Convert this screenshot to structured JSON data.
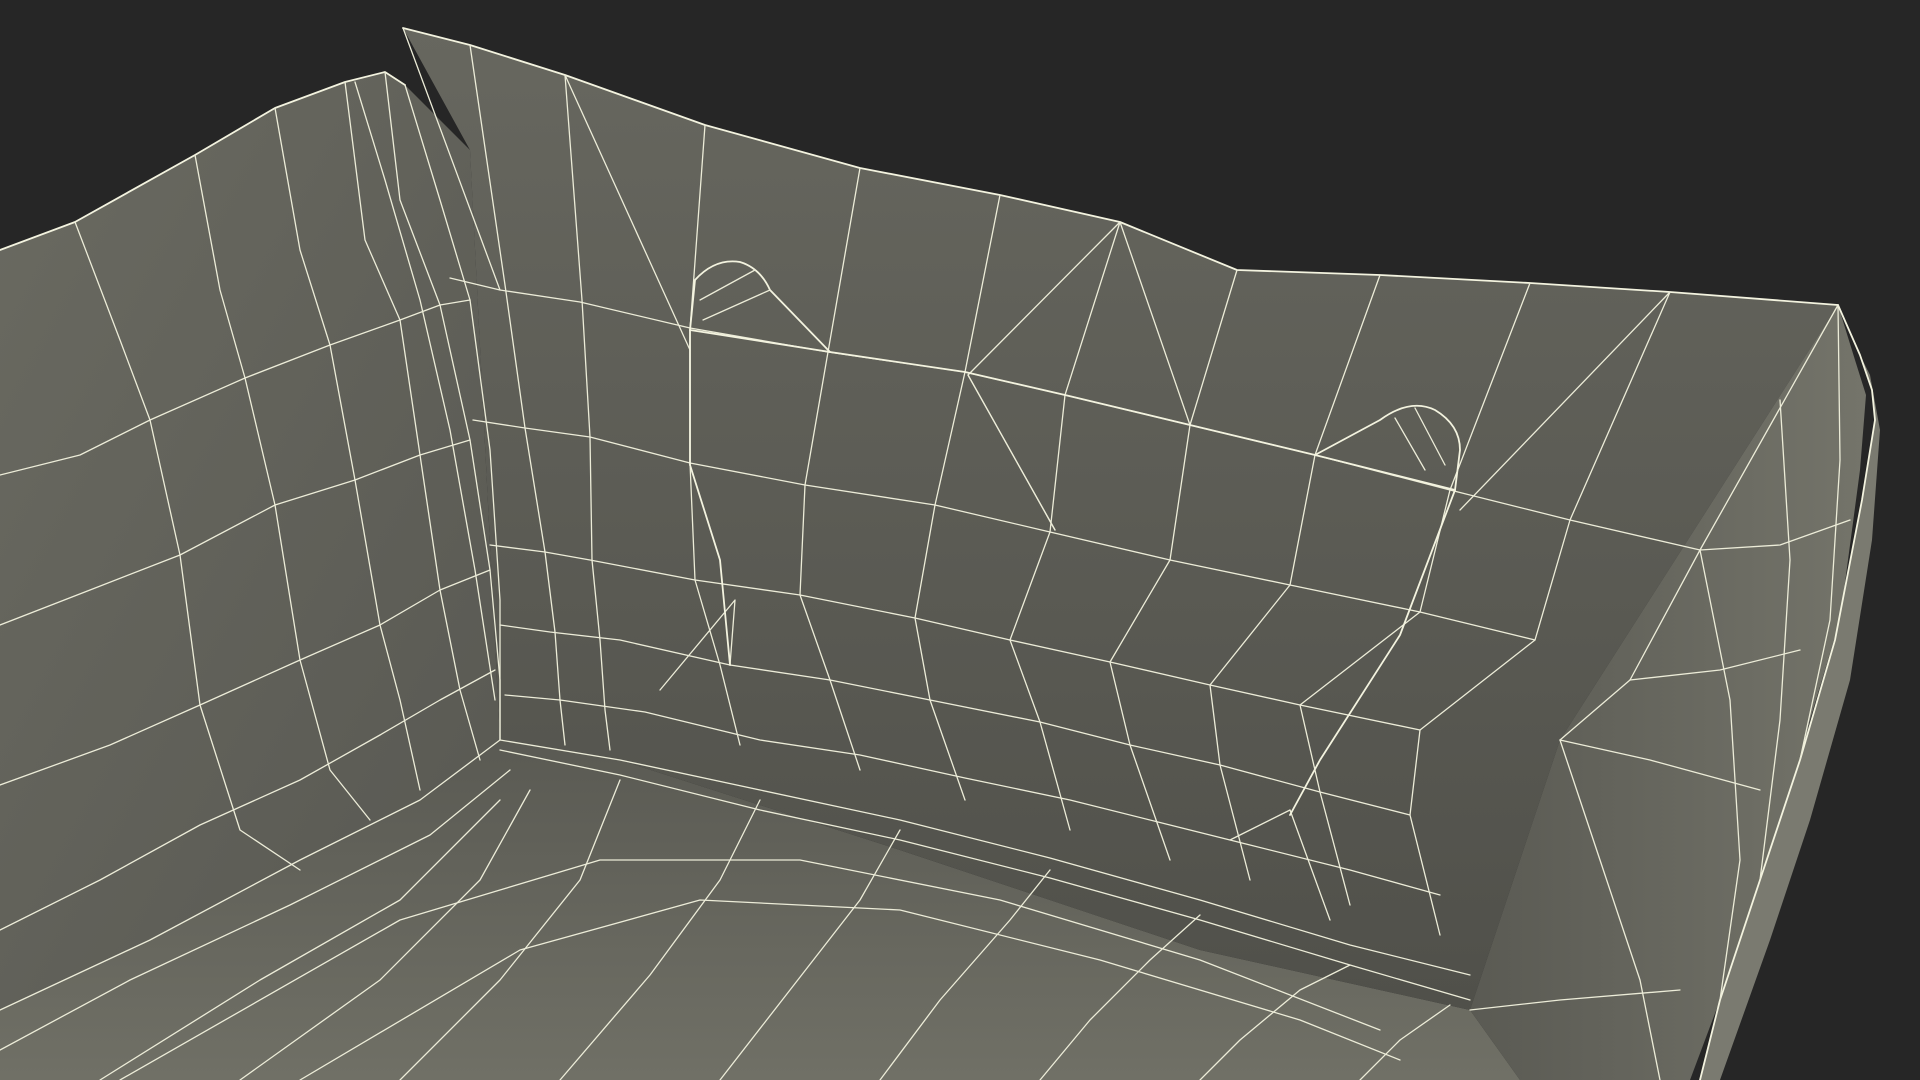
{
  "scene": {
    "background_color": "#262626",
    "surface_color_light": "#6e6e64",
    "surface_color_mid": "#5e5e56",
    "surface_color_dark": "#4e4e48",
    "wireframe_color": "#ececd8",
    "render_mode": "wireframe-on-shaded",
    "subject": "3d-tray-mesh"
  }
}
